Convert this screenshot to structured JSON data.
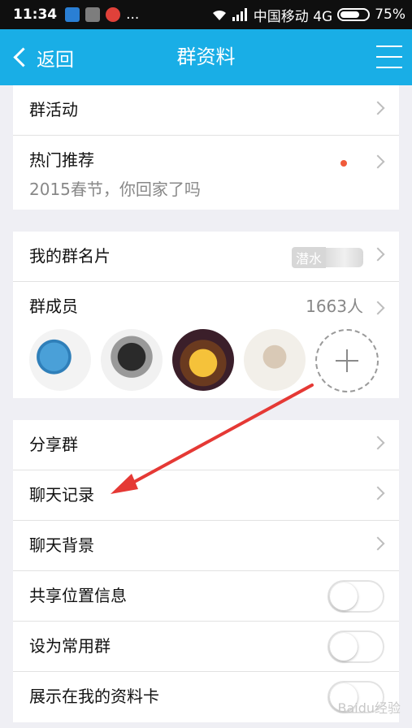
{
  "status_bar": {
    "time": "11:34",
    "dots": "...",
    "carrier": "中国移动 4G",
    "battery": "75%",
    "battery_level": 0.75
  },
  "nav": {
    "back_label": "返回",
    "title": "群资料"
  },
  "group1": {
    "activity_label": "群活动",
    "hot_label": "热门推荐",
    "hot_sub": "2015春节，你回家了吗"
  },
  "group2": {
    "namecard_label": "我的群名片",
    "namecard_value": "潜水",
    "members_label": "群成员",
    "members_count": "1663人"
  },
  "group3": {
    "share_label": "分享群",
    "chat_history_label": "聊天记录",
    "chat_bg_label": "聊天背景",
    "share_location_label": "共享位置信息",
    "set_frequent_label": "设为常用群",
    "show_in_profile_label": "展示在我的资料卡"
  },
  "toggles": {
    "share_location": false,
    "set_frequent": false,
    "show_in_profile": false
  },
  "colors": {
    "accent": "#19aee6",
    "annotation_arrow": "#e53935",
    "red_dot": "#f05a3a"
  },
  "watermark": "Baidu经验"
}
